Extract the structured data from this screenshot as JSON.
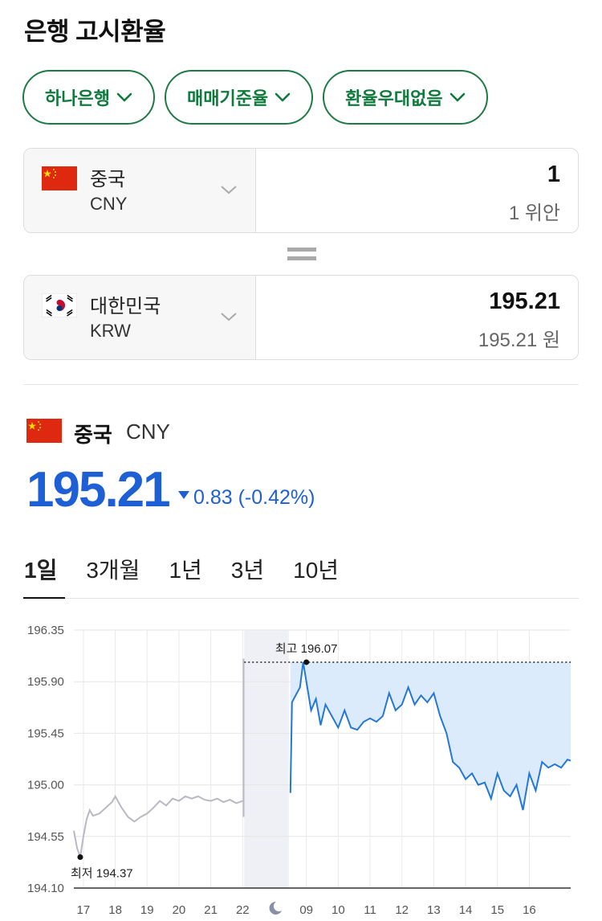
{
  "page_title": "은행 고시환율",
  "filters": [
    {
      "label": "하나은행"
    },
    {
      "label": "매매기준율"
    },
    {
      "label": "환율우대없음"
    }
  ],
  "converter": {
    "from": {
      "country": "중국",
      "code": "CNY",
      "amount": "1",
      "amount_text": "1 위안"
    },
    "to": {
      "country": "대한민국",
      "code": "KRW",
      "amount": "195.21",
      "amount_text": "195.21 원"
    }
  },
  "summary": {
    "country": "중국",
    "code": "CNY",
    "rate": "195.21",
    "change": "0.83 (-0.42%)",
    "direction": "down"
  },
  "tabs": [
    {
      "label": "1일",
      "active": true
    },
    {
      "label": "3개월",
      "active": false
    },
    {
      "label": "1년",
      "active": false
    },
    {
      "label": "3년",
      "active": false
    },
    {
      "label": "10년",
      "active": false
    }
  ],
  "colors": {
    "accent_green": "#0f7a3c",
    "rate_blue": "#1f5fd6",
    "line_blue": "#2378d6",
    "line_gray": "#b9b9c6",
    "area_fill": "#dcebfb",
    "overnight_band": "#eef0f6"
  },
  "chart_data": {
    "type": "line",
    "ylim": [
      194.1,
      196.35
    ],
    "yticks": [
      "196.35",
      "195.90",
      "195.45",
      "195.00",
      "194.55",
      "194.10"
    ],
    "xticks": [
      "17",
      "18",
      "19",
      "20",
      "21",
      "22",
      "moon-icon",
      "09",
      "10",
      "11",
      "12",
      "13",
      "14",
      "15",
      "16"
    ],
    "annotations": {
      "high_label": "최고 196.07",
      "low_label": "최저 194.37",
      "high": 196.07,
      "low": 194.37
    },
    "series": [
      {
        "segment": "previous-session",
        "color": "gray",
        "x": [
          16.7,
          16.8,
          16.9,
          17.0,
          17.1,
          17.2,
          17.3,
          17.5,
          17.7,
          17.9,
          18.0,
          18.2,
          18.4,
          18.6,
          18.8,
          19.0,
          19.2,
          19.4,
          19.6,
          19.8,
          20.0,
          20.2,
          20.4,
          20.6,
          20.8,
          21.0,
          21.2,
          21.4,
          21.6,
          21.8,
          22.0
        ],
        "values": [
          194.6,
          194.45,
          194.37,
          194.55,
          194.7,
          194.78,
          194.73,
          194.75,
          194.8,
          194.85,
          194.9,
          194.8,
          194.72,
          194.68,
          194.72,
          194.75,
          194.8,
          194.86,
          194.82,
          194.88,
          194.86,
          194.9,
          194.88,
          194.9,
          194.87,
          194.86,
          194.88,
          194.85,
          194.87,
          194.84,
          194.86
        ]
      },
      {
        "segment": "current-session",
        "color": "blue",
        "x": [
          23.5,
          23.55,
          23.7,
          23.8,
          23.9,
          24.0,
          24.15,
          24.3,
          24.45,
          24.6,
          24.8,
          25.0,
          25.2,
          25.4,
          25.6,
          25.8,
          26.0,
          26.2,
          26.4,
          26.6,
          26.8,
          27.0,
          27.2,
          27.4,
          27.6,
          27.8,
          28.0,
          28.2,
          28.4,
          28.6,
          28.8,
          29.0,
          29.2,
          29.4,
          29.6,
          29.8,
          30.0,
          30.2,
          30.4,
          30.6,
          30.8,
          31.0,
          31.2,
          31.4,
          31.6,
          31.8,
          32.0,
          32.2,
          32.3
        ],
        "values": [
          194.93,
          195.72,
          195.8,
          195.85,
          196.07,
          195.9,
          195.65,
          195.75,
          195.52,
          195.7,
          195.6,
          195.5,
          195.65,
          195.5,
          195.48,
          195.55,
          195.58,
          195.55,
          195.6,
          195.8,
          195.65,
          195.7,
          195.85,
          195.7,
          195.78,
          195.72,
          195.8,
          195.6,
          195.45,
          195.2,
          195.15,
          195.05,
          195.1,
          195.0,
          195.02,
          194.88,
          195.1,
          194.95,
          194.9,
          195.0,
          194.78,
          195.1,
          194.95,
          195.2,
          195.15,
          195.18,
          195.15,
          195.22,
          195.21
        ]
      }
    ]
  }
}
